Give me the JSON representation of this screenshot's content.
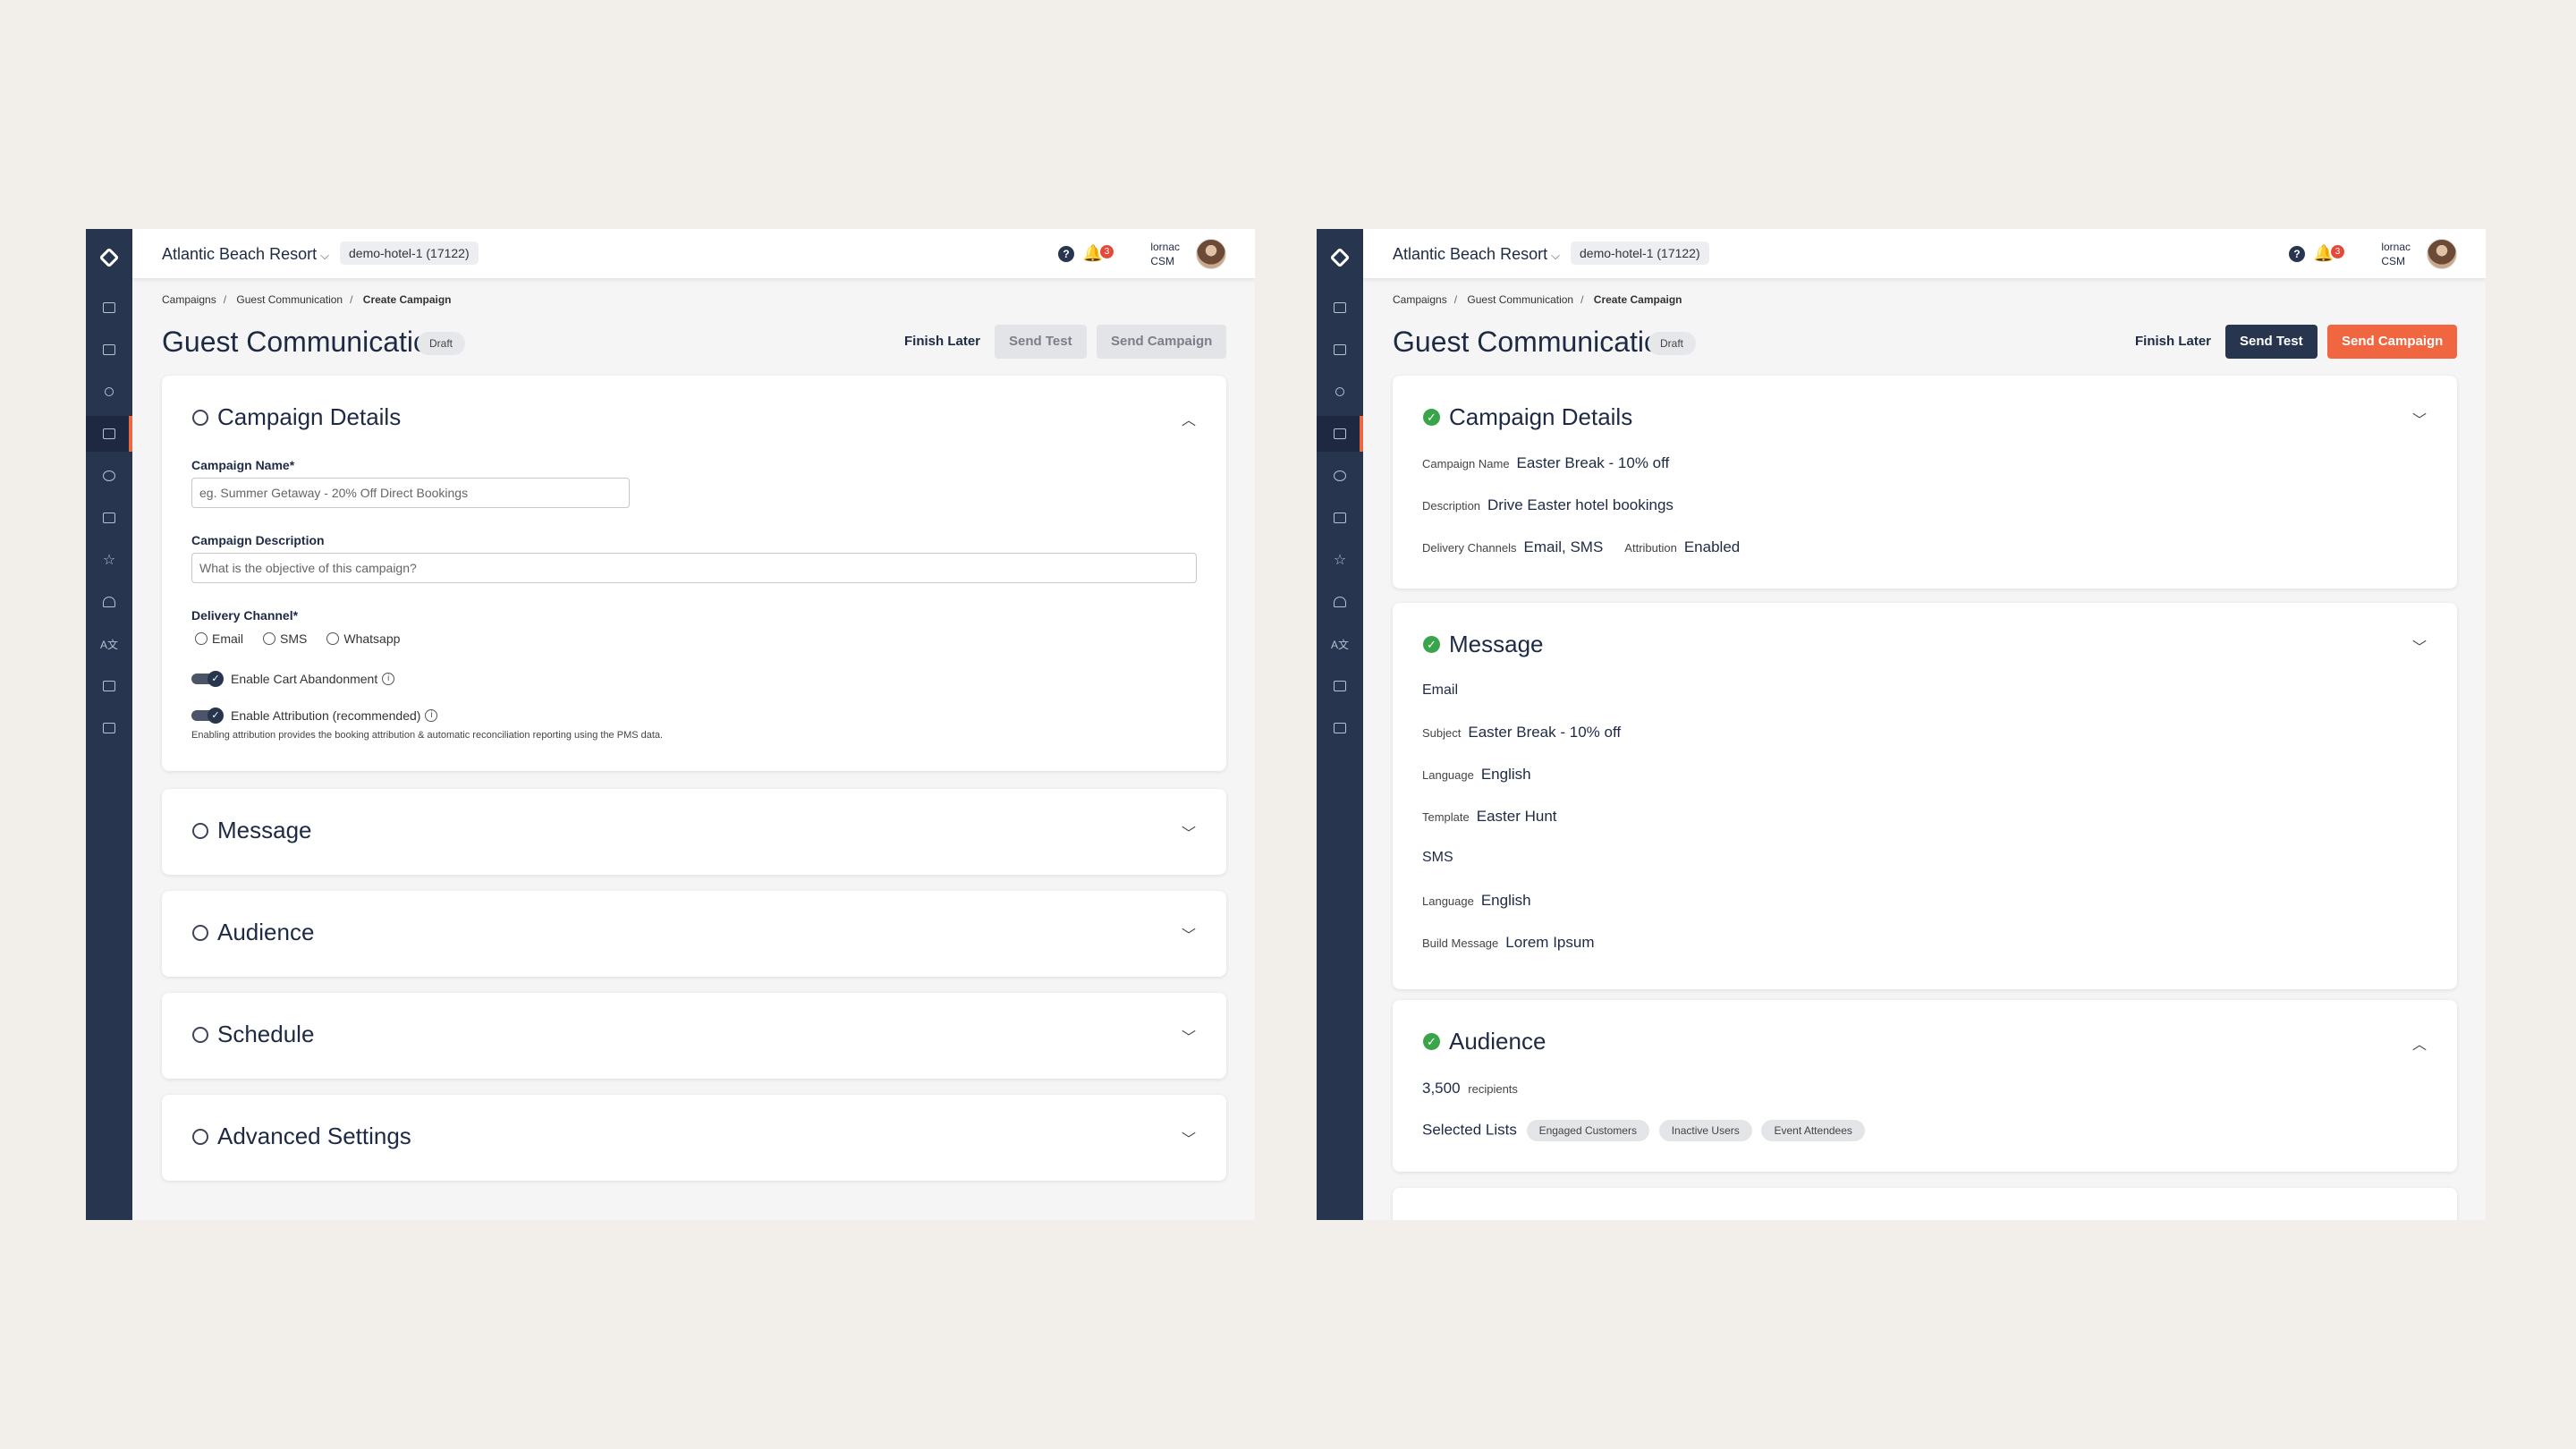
{
  "topbar": {
    "hotel_name": "Atlantic Beach Resort",
    "hotel_id": "demo-hotel-1 (17122)",
    "help_icon": "?",
    "notification_count": "3",
    "user_name": "lornac",
    "user_role": "CSM"
  },
  "breadcrumb": [
    "Campaigns",
    "Guest Communication",
    "Create Campaign"
  ],
  "page": {
    "title": "Guest Communication",
    "status": "Draft",
    "finish_later": "Finish Later",
    "send_test": "Send Test",
    "send_campaign": "Send Campaign"
  },
  "left": {
    "campaign_details": {
      "title": "Campaign Details",
      "name_label": "Campaign Name*",
      "name_placeholder": "eg. Summer Getaway - 20% Off Direct Bookings",
      "desc_label": "Campaign Description",
      "desc_placeholder": "What is the objective of this campaign?",
      "channel_label": "Delivery Channel*",
      "channels": [
        "Email",
        "SMS",
        "Whatsapp"
      ],
      "cart_abandonment": "Enable Cart Abandonment",
      "attribution": "Enable Attribution (recommended)",
      "attribution_help": "Enabling attribution provides the booking attribution & automatic reconciliation reporting using the PMS data."
    },
    "sections": [
      "Message",
      "Audience",
      "Schedule",
      "Advanced Settings"
    ]
  },
  "right": {
    "campaign_details": {
      "title": "Campaign Details",
      "name_label": "Campaign Name",
      "name_value": "Easter Break - 10% off",
      "desc_label": "Description",
      "desc_value": "Drive Easter hotel bookings",
      "channels_label": "Delivery Channels",
      "channels_value": "Email, SMS",
      "attribution_label": "Attribution",
      "attribution_value": "Enabled"
    },
    "message": {
      "title": "Message",
      "email_heading": "Email",
      "subject_label": "Subject",
      "subject_value": "Easter Break - 10% off",
      "language_label": "Language",
      "language_value": "English",
      "template_label": "Template",
      "template_value": "Easter Hunt",
      "sms_heading": "SMS",
      "sms_language_label": "Language",
      "sms_language_value": "English",
      "build_label": "Build Message",
      "build_value": "Lorem Ipsum"
    },
    "audience": {
      "title": "Audience",
      "recipients_count": "3,500",
      "recipients_label": "recipients",
      "lists_label": "Selected Lists",
      "lists": [
        "Engaged Customers",
        "Inactive Users",
        "Event Attendees"
      ]
    }
  },
  "icons": {
    "rail": [
      "logo-icon",
      "dashboard-icon",
      "clipboard-icon",
      "user-icon",
      "campaigns-icon",
      "chat-icon",
      "inbox-icon",
      "star-icon",
      "concierge-icon",
      "translate-icon",
      "bed-icon",
      "id-card-icon"
    ],
    "colors": {
      "rail": "#28354f",
      "accent": "#ef6640",
      "success": "#3aa44b"
    }
  }
}
